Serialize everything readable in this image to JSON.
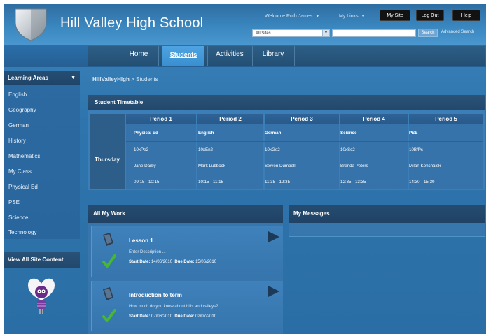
{
  "header": {
    "site_title": "Hill Valley High School",
    "welcome_text": "Welcome Ruth James",
    "my_links": "My Links",
    "my_site": "My Site",
    "log_out": "Log Out",
    "help": "Help",
    "sites_select": "All Sites",
    "search_button": "Search",
    "advanced_search": "Advanced Search"
  },
  "nav": {
    "tabs": [
      {
        "label": "Home",
        "active": false
      },
      {
        "label": "Students",
        "active": true
      },
      {
        "label": "Activities",
        "active": false
      },
      {
        "label": "Library",
        "active": false
      }
    ]
  },
  "sidebar": {
    "header": "Learning Areas",
    "items": [
      "English",
      "Geography",
      "German",
      "History",
      "Mathematics",
      "My Class",
      "Physical Ed",
      "PSE",
      "Science",
      "Technology"
    ],
    "view_all": "View All Site Content"
  },
  "breadcrumb": {
    "root": "HillValleyHigh",
    "separator": " > ",
    "current": "Students"
  },
  "timetable": {
    "title": "Student Timetable",
    "day": "Thursday",
    "periods": [
      {
        "label": "Period 1",
        "subject": "Physical Ed",
        "class": "10xPe2",
        "teacher": "Jane Darby",
        "time": "09:15 - 10:15"
      },
      {
        "label": "Period 2",
        "subject": "English",
        "class": "10xEn2",
        "teacher": "Mark Lubbock",
        "time": "10:15 - 11:15"
      },
      {
        "label": "Period 3",
        "subject": "German",
        "class": "10xGe2",
        "teacher": "Steven Dumbell",
        "time": "11:35 - 12:35"
      },
      {
        "label": "Period 4",
        "subject": "Science",
        "class": "10xSc2",
        "teacher": "Brenda Peters",
        "time": "12:35 - 13:35"
      },
      {
        "label": "Period 5",
        "subject": "PSE",
        "class": "10B/Ps",
        "teacher": "Milan Konchalski",
        "time": "14:30 - 15:30"
      }
    ]
  },
  "work": {
    "title": "All My Work",
    "start_label": "Start Date:",
    "due_label": "Due Date:",
    "items": [
      {
        "title": "Lesson 1",
        "description": "Enter Description ...",
        "start": "14/06/2010",
        "due": "15/06/2010"
      },
      {
        "title": "Introduction to term",
        "description": "How much do you know about hills and valleys? ...",
        "start": "07/06/2010",
        "due": "02/07/2010"
      }
    ]
  },
  "messages": {
    "title": "My Messages"
  },
  "colors": {
    "accent_tab": "#4ea3e1",
    "work_item_border": "#d2781d",
    "check_green": "#46b735"
  }
}
